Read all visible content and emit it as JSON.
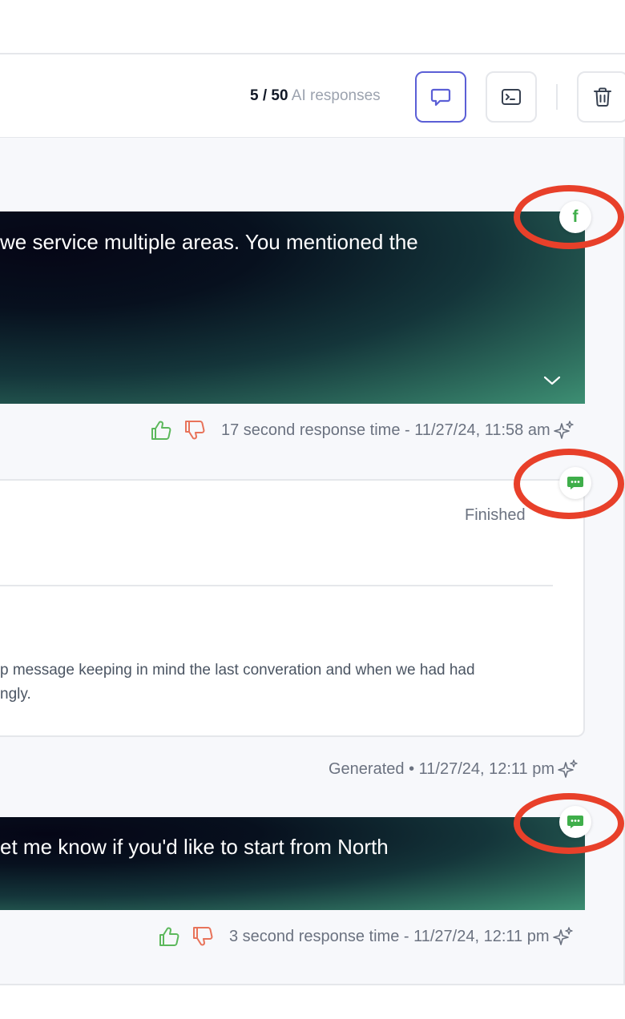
{
  "header": {
    "counter_value": "5 / 50",
    "counter_label": "AI responses"
  },
  "messages": [
    {
      "text": "we service multiple areas. You mentioned the",
      "channel_icon": "facebook-icon",
      "meta": "17 second response time - 11/27/24, 11:58 am"
    },
    {
      "text": "et me know if you'd like to start from North",
      "channel_icon": "chat-icon",
      "meta": "3 second response time - 11/27/24, 12:11 pm"
    }
  ],
  "task_card": {
    "status": "Finished",
    "body_line1": "p message keeping in mind the last converation and when we had had",
    "body_line2": "ngly.",
    "channel_icon": "chat-icon",
    "meta": "Generated • 11/27/24, 12:11 pm"
  },
  "colors": {
    "accent": "#5b5fd6",
    "highlight_ring": "#e8402a",
    "thumb_up": "#5cb85c",
    "thumb_down": "#e8735a",
    "channel_green": "#3fae4a"
  }
}
